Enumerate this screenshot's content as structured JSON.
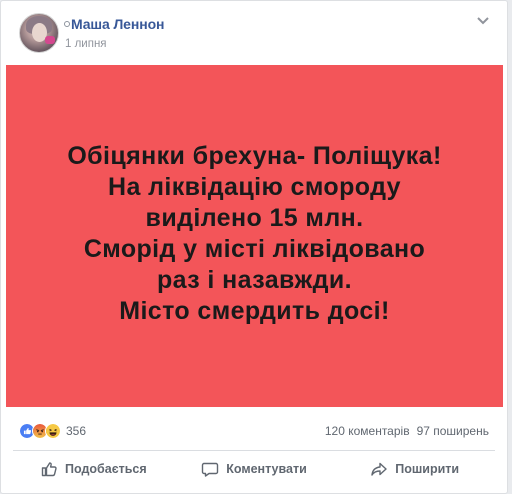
{
  "post": {
    "author": "Маша Леннон",
    "date": "1 липня",
    "lines": [
      "Обіцянки брехуна- Поліщука!",
      "На ліквідацію смороду",
      "виділено 15 млн.",
      "Сморід у місті ліквідовано",
      "раз і назавжди.",
      "Місто смердить досі!"
    ],
    "background_color": "#f35559"
  },
  "stats": {
    "reactions": [
      "like-icon",
      "angry-icon",
      "haha-icon"
    ],
    "reaction_count": "356",
    "comments": "120 коментарів",
    "shares": "97 поширень"
  },
  "actions": {
    "like": "Подобається",
    "comment": "Коментувати",
    "share": "Поширити"
  },
  "colors": {
    "link": "#385898",
    "muted": "#606770"
  }
}
